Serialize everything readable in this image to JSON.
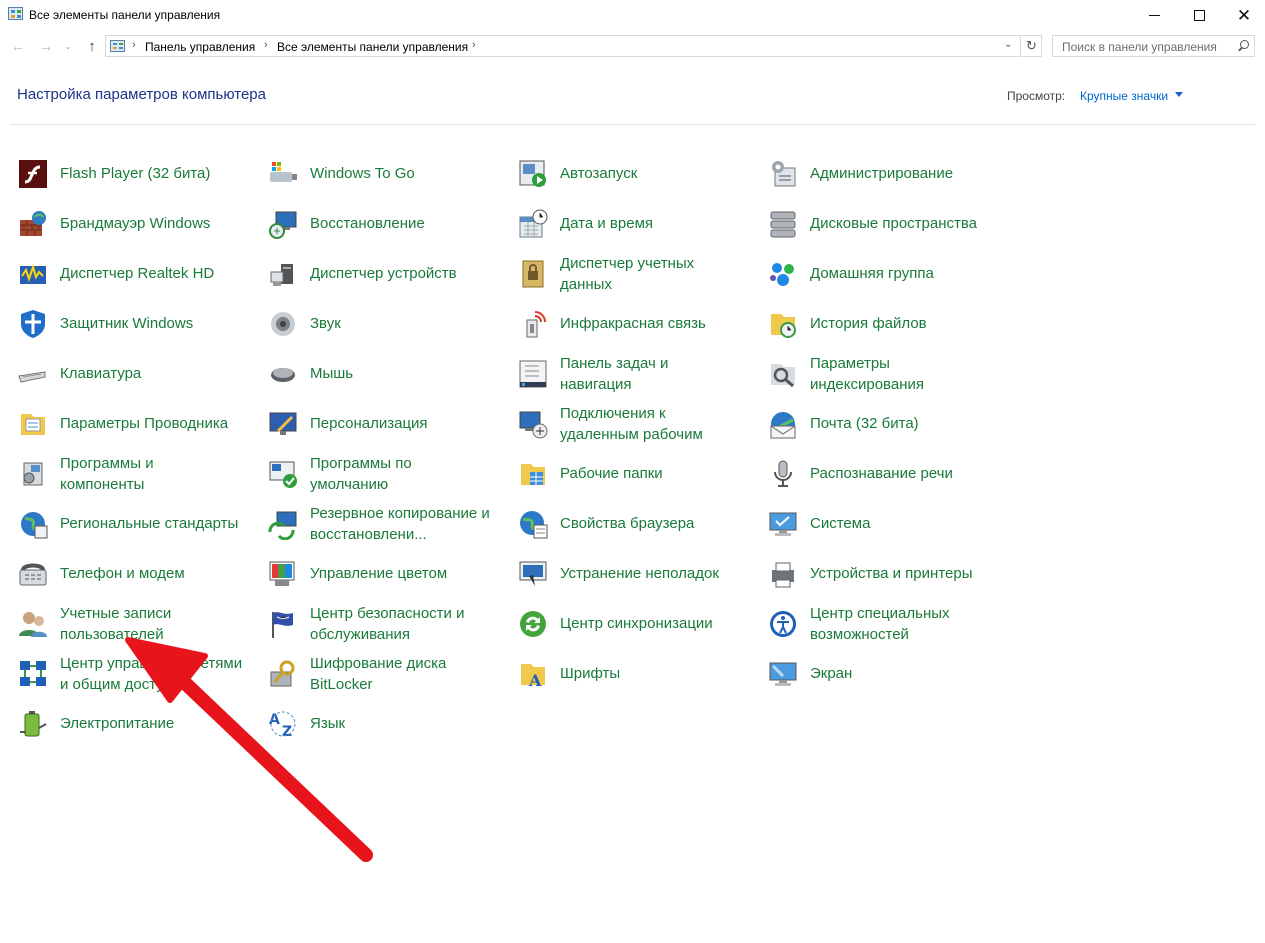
{
  "window": {
    "title": "Все элементы панели управления",
    "close_glyph": "✕"
  },
  "navigation": {
    "back_icon": "arrow-left-icon",
    "forward_icon": "arrow-right-icon",
    "up_icon": "arrow-up-icon",
    "back_glyph": "←",
    "forward_glyph": "→",
    "recent_glyph": "⌄",
    "up_glyph": "↑",
    "breadcrumb": [
      "Панель управления",
      "Все элементы панели управления"
    ],
    "breadcrumb_sep": "›",
    "dropdown_glyph": "⌄",
    "refresh_glyph": "↻",
    "search_placeholder": "Поиск в панели управления"
  },
  "header": {
    "title": "Настройка параметров компьютера",
    "view_label": "Просмотр:",
    "view_value": "Крупные значки"
  },
  "items": [
    [
      "Flash Player (32 бита)",
      "Windows To Go",
      "Автозапуск",
      "Администрирование"
    ],
    [
      "Брандмауэр Windows",
      "Восстановление",
      "Дата и время",
      "Дисковые пространства"
    ],
    [
      "Диспетчер Realtek HD",
      "Диспетчер устройств",
      "Диспетчер учетных|данных",
      "Домашняя группа"
    ],
    [
      "Защитник Windows",
      "Звук",
      "Инфракрасная связь",
      "История файлов"
    ],
    [
      "Клавиатура",
      "Мышь",
      "Панель задач и|навигация",
      "Параметры|индексирования"
    ],
    [
      "Параметры Проводника",
      "Персонализация",
      "Подключения к|удаленным рабочим",
      "Почта (32 бита)"
    ],
    [
      "Программы и|компоненты",
      "Программы по|умолчанию",
      "Рабочие папки",
      "Распознавание речи"
    ],
    [
      "Региональные стандарты",
      "Резервное копирование и|восстановлени...",
      "Свойства браузера",
      "Система"
    ],
    [
      "Телефон и модем",
      "Управление цветом",
      "Устранение неполадок",
      "Устройства и принтеры"
    ],
    [
      "Учетные записи|пользователей",
      "Центр безопасности и|обслуживания",
      "Центр синхронизации",
      "Центр специальных|возможностей"
    ],
    [
      "Центр управления сетями|и общим доступом",
      "Шифрование диска|BitLocker",
      "Шрифты",
      "Экран"
    ],
    [
      "Электропитание",
      "Язык",
      null,
      null
    ]
  ],
  "colors": {
    "item_text": "#1a7a3a",
    "title_text": "#1e3287",
    "link": "#0066cc",
    "annotation_arrow": "#e8141c"
  }
}
